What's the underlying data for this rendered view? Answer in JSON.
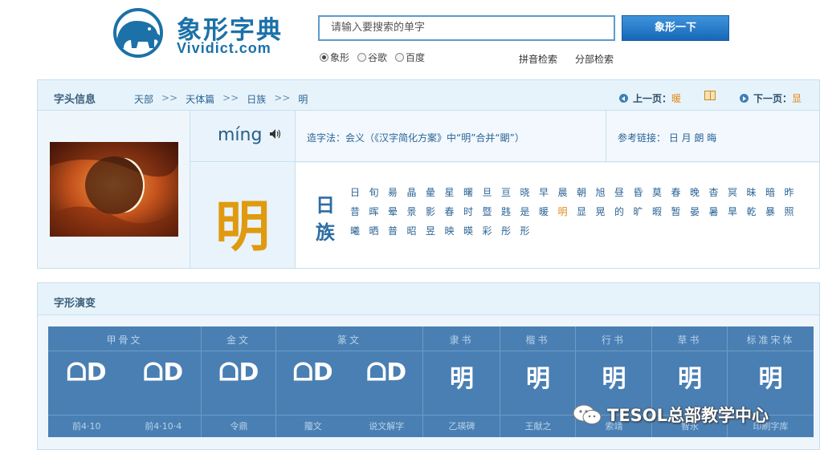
{
  "header": {
    "logo_title": "象形字典",
    "logo_sub": "Vividict.com",
    "search_placeholder": "请输入要搜索的单字",
    "search_button": "象形一下",
    "radios": [
      {
        "label": "象形",
        "checked": true
      },
      {
        "label": "谷歌",
        "checked": false
      },
      {
        "label": "百度",
        "checked": false
      }
    ],
    "pinyin_search": "拼音检索",
    "bushou_search": "分部检索"
  },
  "info": {
    "title": "字头信息",
    "breadcrumb": [
      "天部",
      "天体篇",
      "日族",
      "明"
    ],
    "breadcrumb_sep": ">>",
    "prev_label": "上一页：",
    "prev_char": "暖",
    "next_label": "下一页：",
    "next_char": "显",
    "pinyin": "míng",
    "char": "明",
    "description": "造字法：会义（《汉字简化方案》中“明”合并“朙”）",
    "reference": "参考链接： 日  月  朗  晦",
    "family_label": "日族",
    "family_chars": [
      "日",
      "旬",
      "昜",
      "晶",
      "曐",
      "星",
      "曙",
      "旦",
      "亘",
      "晓",
      "早",
      "晨",
      "朝",
      "旭",
      "昼",
      "昏",
      "莫",
      "春",
      "晚",
      "杳",
      "冥",
      "昧",
      "暗",
      "昨",
      "昔",
      "晖",
      "晕",
      "景",
      "影",
      "春",
      "时",
      "暨",
      "韪",
      "是",
      "暖",
      "明",
      "显",
      "晃",
      "的",
      "旷",
      "暇",
      "暂",
      "晏",
      "暑",
      "旱",
      "乾",
      "暴",
      "照",
      "曦",
      "晒",
      "普",
      "昭",
      "昱",
      "映",
      "暎",
      "彩",
      "彤",
      "形"
    ],
    "family_current": "明"
  },
  "evolution": {
    "title": "字形演变",
    "columns": [
      {
        "label": "甲骨文",
        "glyphs": [
          "ᗝD",
          "ᗝD"
        ],
        "sources": [
          "前4·10",
          "前4·10·4"
        ]
      },
      {
        "label": "金文",
        "glyphs": [
          "ᗝD"
        ],
        "sources": [
          "令鼎"
        ]
      },
      {
        "label": "篆文",
        "glyphs": [
          "ᗝD",
          "ᗝD"
        ],
        "sources": [
          "籀文",
          "说文解字"
        ]
      },
      {
        "label": "隶书",
        "glyphs": [
          "明"
        ],
        "sources": [
          "乙瑛碑"
        ]
      },
      {
        "label": "楷书",
        "glyphs": [
          "明"
        ],
        "sources": [
          "王献之"
        ]
      },
      {
        "label": "行书",
        "glyphs": [
          "明"
        ],
        "sources": [
          "索靖"
        ]
      },
      {
        "label": "草书",
        "glyphs": [
          "明"
        ],
        "sources": [
          "智永"
        ]
      },
      {
        "label": "标准宋体",
        "glyphs": [
          "明"
        ],
        "sources": [
          "印刷字库"
        ]
      }
    ]
  },
  "watermark": "TESOL总部教学中心"
}
